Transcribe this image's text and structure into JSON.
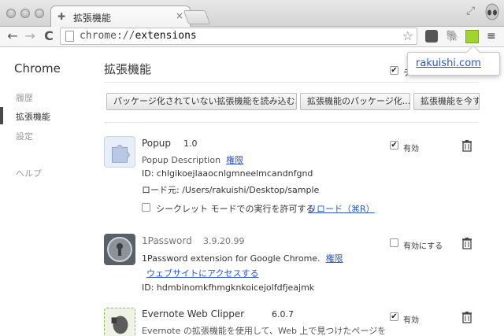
{
  "tab": {
    "title": "拡張機能",
    "close": "×"
  },
  "toolbar": {
    "back": "←",
    "forward": "→",
    "reload": "C",
    "url_scheme": "chrome://",
    "url_path": "extensions",
    "star": "☆",
    "menu": "≡"
  },
  "sidebar": {
    "title": "Chrome",
    "items": [
      {
        "label": "履歴"
      },
      {
        "label": "拡張機能"
      },
      {
        "label": "設定"
      },
      {
        "label": "ヘルプ"
      }
    ]
  },
  "main": {
    "title": "拡張機能",
    "dev_mode_label": "デ",
    "buttons": [
      "パッケージ化されていない拡張機能を読み込む...",
      "拡張機能のパッケージ化...",
      "拡張機能を今すぐ"
    ]
  },
  "extensions": [
    {
      "name": "Popup",
      "version": "1.0",
      "description": "Popup Description",
      "permissions_link": "権限",
      "id_line": "ID: chlgikoejlaaocnlgmneelmcandnfgnd",
      "load_line": "ロード元: /Users/rakuishi/Desktop/sample",
      "incognito_label": "シークレット モードでの実行を許可する",
      "reload_link": "リロード（⌘R）",
      "enable_label": "有効",
      "enabled": true
    },
    {
      "name": "1Password",
      "version": "3.9.20.99",
      "description": "1Password extension for Google Chrome.",
      "permissions_link": "権限",
      "website_link": "ウェブサイトにアクセスする",
      "id_line": "ID: hdmbinomkfhmgknkoicejolfdfjeajmk",
      "enable_label": "有効にする",
      "enabled": false
    },
    {
      "name": "Evernote Web Clipper",
      "version": "6.0.7",
      "description": "Evernote の拡張機能を使用して、Web 上で見つけたページを",
      "enable_label": "有効",
      "enabled": true
    }
  ],
  "popup": {
    "link": "rakuishi.com"
  },
  "colors": {
    "link": "#2a55cc",
    "green_extension": "#a0d62b"
  }
}
